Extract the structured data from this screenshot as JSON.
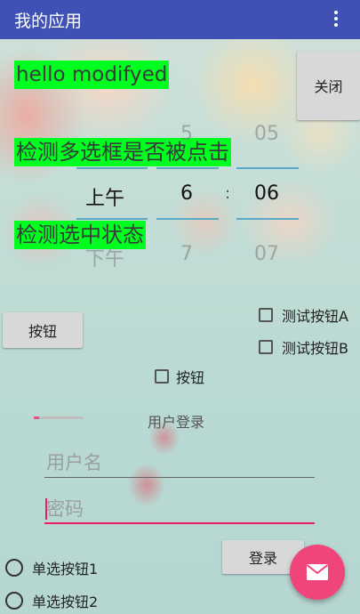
{
  "app": {
    "title": "我的应用",
    "overflow_icon": "more-vert-icon",
    "bar_color": "#3f51b5"
  },
  "labels": {
    "hello": "hello modifyed",
    "check_clicked": "检测多选框是否被点击",
    "check_state": "检测选中状态",
    "login_title": "用户登录"
  },
  "buttons": {
    "close": "关闭",
    "button": "按钮",
    "login": "登录"
  },
  "time_picker": {
    "above": {
      "ampm": "",
      "hour": "5",
      "minute": "05"
    },
    "selected": {
      "ampm": "上午",
      "hour": "6",
      "separator": ":",
      "minute": "06"
    },
    "below": {
      "ampm": "下午",
      "hour": "7",
      "minute": "07"
    }
  },
  "checkboxes": [
    {
      "label": "测试按钮A",
      "checked": false
    },
    {
      "label": "测试按钮B",
      "checked": false
    },
    {
      "label": "按钮",
      "checked": false
    }
  ],
  "inputs": {
    "username": {
      "placeholder": "用户名",
      "value": ""
    },
    "password": {
      "placeholder": "密码",
      "value": ""
    }
  },
  "radios": [
    {
      "label": "单选按钮1",
      "checked": false
    },
    {
      "label": "单选按钮2",
      "checked": false
    }
  ],
  "progress": {
    "fraction": 0.1
  },
  "fab": {
    "icon": "email-icon",
    "color": "#f0457a"
  }
}
